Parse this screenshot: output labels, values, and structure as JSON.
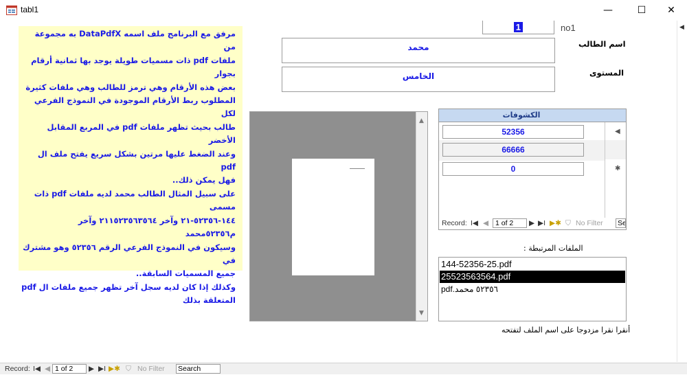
{
  "window": {
    "title": "tabl1",
    "icon": "form-icon",
    "controls": {
      "minimize": "—",
      "maximize": "☐",
      "close": "✕"
    }
  },
  "info_text": "مرفق مع البرنامج ملف اسمه DataPdfX به مجموعة من\nملفات pdf ذات مسميات طويلة يوجد بها ثمانية أرقام بجوار\nبعض هذه الأرقام وهي ترمز للطالب وهي ملفات كثيرة\nالمطلوب ربط الأرقام الموجودة في النموذج الفرعي لكل\nطالب بحيث تظهر ملفات pdf في المربع المقابل الأخضر\nوعند الضغط عليها مرتين بشكل سريع يفتح ملف ال pdf\nفهل يمكن ذلك..\nعلى سبيل المثال الطالب محمد لديه ملفات pdf ذات مسمى\n١٤٤-٥٢٣٥٦-٢١ وآخر ٢١١٥٢٣٥٦٣٥٦٤ وآخر\nم٥٢٣٥٦محمد\nوسيكون في النموذج الفرعي الرقم ٥٢٣٥٦ وهو مشترك في\nجميع المسميات السابقة..\nوكذلك إذا كان لديه سجل آخر تظهر جميع ملفات ال pdf\nالمتعلقة بذلك",
  "form": {
    "id_value": "1",
    "id_label": "no1",
    "student_label": "اسم الطالب",
    "student_value": "محمد",
    "level_label": "المستوى",
    "level_value": "الخامس"
  },
  "subform": {
    "header": "الكشوفات",
    "rows": [
      "52356",
      "66666",
      "0"
    ],
    "row_selectors": [
      "◀",
      "",
      "✱"
    ],
    "nav": {
      "record_label": "Record:",
      "first": "I◀",
      "prev": "◀",
      "current": "1 of 2",
      "next": "▶",
      "last": "▶I",
      "new": "▶✱",
      "filter": "No Filter",
      "search": "Sea"
    }
  },
  "files": {
    "label": "الملفات المرتبطة :",
    "items": [
      "144-52356-25.pdf",
      "25523563564.pdf",
      "pdf.٥٢٣٥٦ محمد"
    ],
    "selected_index": 1,
    "hint": "أنقرا نقرا مزدوجا على اسم الملف لتفتحه"
  },
  "main_nav": {
    "record_label": "Record:",
    "first": "I◀",
    "prev": "◀",
    "current": "1 of 2",
    "next": "▶",
    "last": "▶I",
    "new": "▶✱",
    "filter": "No Filter",
    "search": "Search"
  },
  "colors": {
    "accent_text": "#1a1ae6",
    "info_bg": "#ffffc8",
    "subform_header": "#c6d9f1",
    "viewer_bg": "#8f8f8f"
  }
}
